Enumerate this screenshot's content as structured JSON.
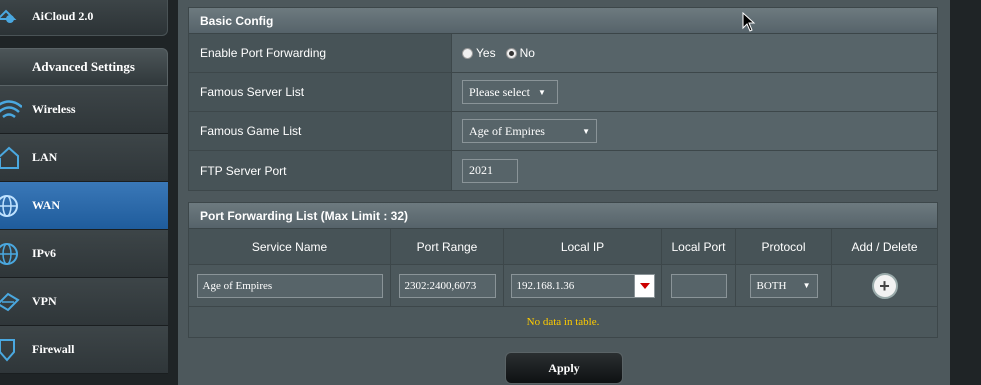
{
  "sidebar": {
    "top_item": "AiCloud 2.0",
    "advanced_header": "Advanced Settings",
    "items": [
      {
        "label": "Wireless",
        "icon": "wifi-icon"
      },
      {
        "label": "LAN",
        "icon": "home-icon"
      },
      {
        "label": "WAN",
        "icon": "globe-icon",
        "active": true
      },
      {
        "label": "IPv6",
        "icon": "ipv6-globe-icon"
      },
      {
        "label": "VPN",
        "icon": "vpn-icon"
      },
      {
        "label": "Firewall",
        "icon": "shield-icon"
      }
    ]
  },
  "basic_config": {
    "title": "Basic Config",
    "enable_port_forwarding": {
      "label": "Enable Port Forwarding",
      "yes": "Yes",
      "no": "No",
      "selected": "No"
    },
    "famous_server_list": {
      "label": "Famous Server List",
      "value": "Please select"
    },
    "famous_game_list": {
      "label": "Famous Game List",
      "value": "Age of Empires"
    },
    "ftp_server_port": {
      "label": "FTP Server Port",
      "value": "2021"
    }
  },
  "port_forwarding_list": {
    "title": "Port Forwarding List (Max Limit : 32)",
    "columns": [
      "Service Name",
      "Port Range",
      "Local IP",
      "Local Port",
      "Protocol",
      "Add / Delete"
    ],
    "input_row": {
      "service_name": "Age of Empires",
      "port_range": "2302:2400,6073",
      "local_ip": "192.168.1.36",
      "local_port": "",
      "protocol": "BOTH"
    },
    "empty_message": "No data in table."
  },
  "apply_label": "Apply",
  "colors": {
    "accent": "#2e6fb0",
    "warning_text": "#ffcc00"
  }
}
